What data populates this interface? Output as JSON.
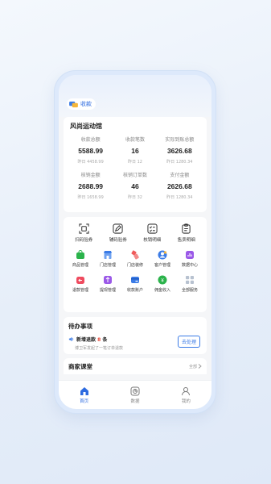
{
  "header": {
    "store_button_label": "收款"
  },
  "summary": {
    "store_name": "风尚运动馆",
    "stats": [
      {
        "label": "收款总额",
        "value": "5588.99",
        "sub": "昨日 4458.99"
      },
      {
        "label": "收款笔数",
        "value": "16",
        "sub": "昨日 12"
      },
      {
        "label": "实际到账总额",
        "value": "3626.68",
        "sub": "昨日 1280.34"
      },
      {
        "label": "核销金额",
        "value": "2688.99",
        "sub": "昨日 1658.99"
      },
      {
        "label": "核销订单数",
        "value": "46",
        "sub": "昨日 32"
      },
      {
        "label": "支付金额",
        "value": "2626.68",
        "sub": "昨日 1280.34"
      }
    ]
  },
  "quick": [
    {
      "label": "扫码验券",
      "icon": "scan-icon"
    },
    {
      "label": "辅码验券",
      "icon": "edit-code-icon"
    },
    {
      "label": "核销明细",
      "icon": "checklist-icon"
    },
    {
      "label": "售卖明细",
      "icon": "clipboard-icon"
    }
  ],
  "grid_row1": [
    {
      "label": "商品管理",
      "icon": "bag-icon",
      "color": "#2bb34b"
    },
    {
      "label": "门店管理",
      "icon": "store-icon",
      "color": "#3b7be6"
    },
    {
      "label": "门店装修",
      "icon": "decor-icon",
      "color": "#ef5a5a"
    },
    {
      "label": "客户管理",
      "icon": "customer-icon",
      "color": "#3b7be6"
    },
    {
      "label": "数据中心",
      "icon": "data-icon",
      "color": "#9b59e8"
    }
  ],
  "grid_row2": [
    {
      "label": "退款管理",
      "icon": "refund-icon",
      "color": "#ef4b5f"
    },
    {
      "label": "提现管理",
      "icon": "withdraw-icon",
      "color": "#9b59e8"
    },
    {
      "label": "收款账户",
      "icon": "account-icon",
      "color": "#3b7be6"
    },
    {
      "label": "佣金收入",
      "icon": "commission-icon",
      "color": "#2bb34b"
    },
    {
      "label": "全部服务",
      "icon": "all-services-icon",
      "color": "#b8c2d0"
    }
  ],
  "todo": {
    "title": "待办事项",
    "item_prefix": "新增退款",
    "item_count": "8",
    "item_suffix": "条",
    "item_sub": "博卫军发起了一笔订单退款",
    "button": "去处理"
  },
  "course": {
    "title": "商家课堂",
    "more": "全部"
  },
  "tabs": [
    {
      "label": "首页",
      "icon": "home-icon",
      "active": true
    },
    {
      "label": "数据",
      "icon": "chart-icon",
      "active": false
    },
    {
      "label": "我的",
      "icon": "user-icon",
      "active": false
    }
  ],
  "colors": {
    "accent": "#2d6be0",
    "alert": "#e74c3c"
  }
}
